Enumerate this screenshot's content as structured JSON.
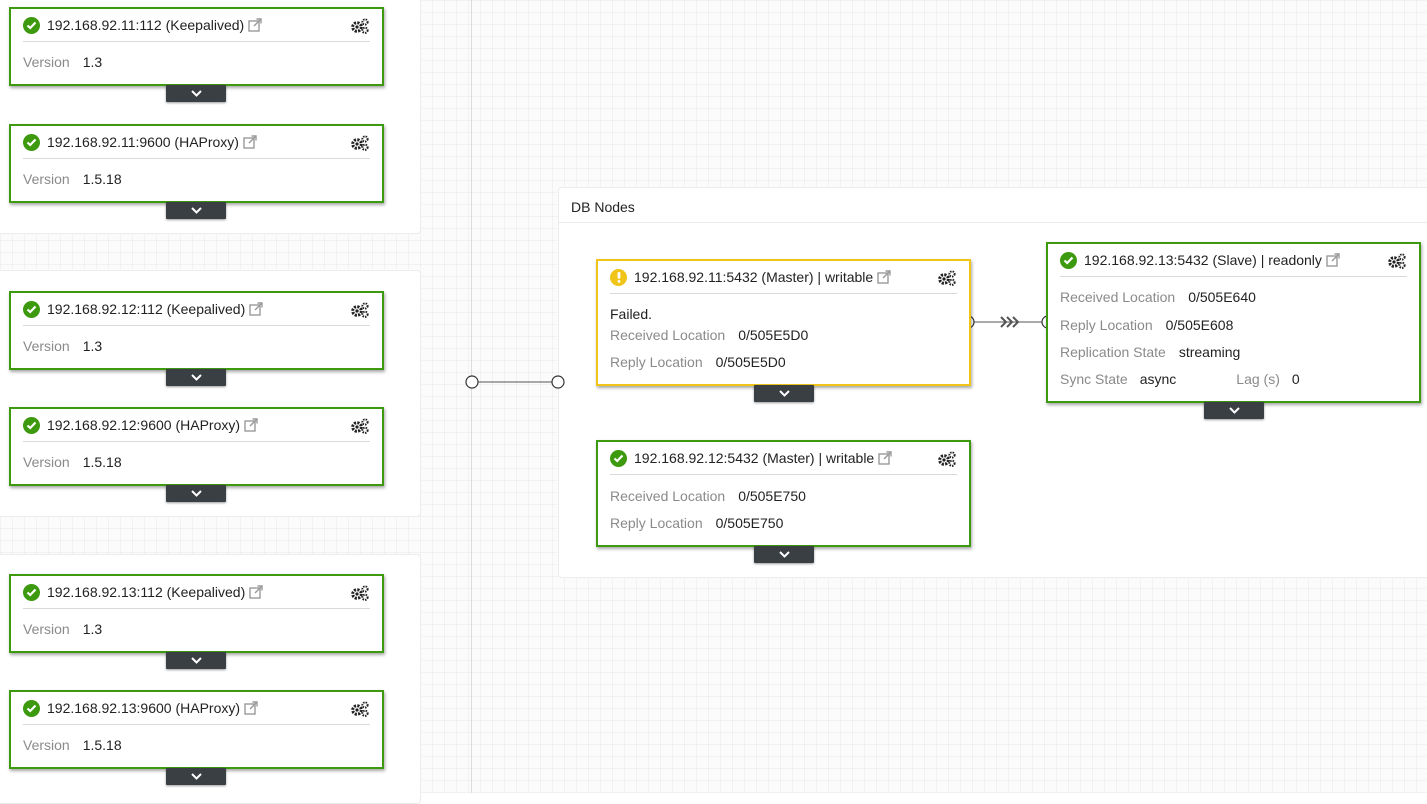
{
  "colors": {
    "ok": "#3d9a0f",
    "warning": "#f0c419",
    "toggle": "#3a3f44"
  },
  "icons": {
    "status_ok": "check-circle-icon",
    "status_warning": "exclamation-circle-icon",
    "external": "external-link-icon",
    "settings": "gears-icon",
    "expand": "chevron-down-icon",
    "replication": "triple-chevron-right-icon"
  },
  "lb_nodes": [
    {
      "title": "192.168.92.11:112 (Keepalived)",
      "version_label": "Version",
      "version": "1.3"
    },
    {
      "title": "192.168.92.11:9600 (HAProxy)",
      "version_label": "Version",
      "version": "1.5.18"
    },
    {
      "title": "192.168.92.12:112 (Keepalived)",
      "version_label": "Version",
      "version": "1.3"
    },
    {
      "title": "192.168.92.12:9600 (HAProxy)",
      "version_label": "Version",
      "version": "1.5.18"
    },
    {
      "title": "192.168.92.13:112 (Keepalived)",
      "version_label": "Version",
      "version": "1.3"
    },
    {
      "title": "192.168.92.13:9600 (HAProxy)",
      "version_label": "Version",
      "version": "1.5.18"
    }
  ],
  "db_group": {
    "title": "DB Nodes",
    "master_failed": {
      "title": "192.168.92.11:5432 (Master) | writable",
      "status": "Failed.",
      "received_label": "Received Location",
      "received": "0/505E5D0",
      "reply_label": "Reply Location",
      "reply": "0/505E5D0"
    },
    "master_ok": {
      "title": "192.168.92.12:5432 (Master) | writable",
      "received_label": "Received Location",
      "received": "0/505E750",
      "reply_label": "Reply Location",
      "reply": "0/505E750"
    },
    "slave": {
      "title": "192.168.92.13:5432 (Slave) | readonly",
      "received_label": "Received Location",
      "received": "0/505E640",
      "reply_label": "Reply Location",
      "reply": "0/505E608",
      "repl_state_label": "Replication State",
      "repl_state": "streaming",
      "sync_state_label": "Sync State",
      "sync_state": "async",
      "lag_label": "Lag (s)",
      "lag": "0"
    }
  }
}
